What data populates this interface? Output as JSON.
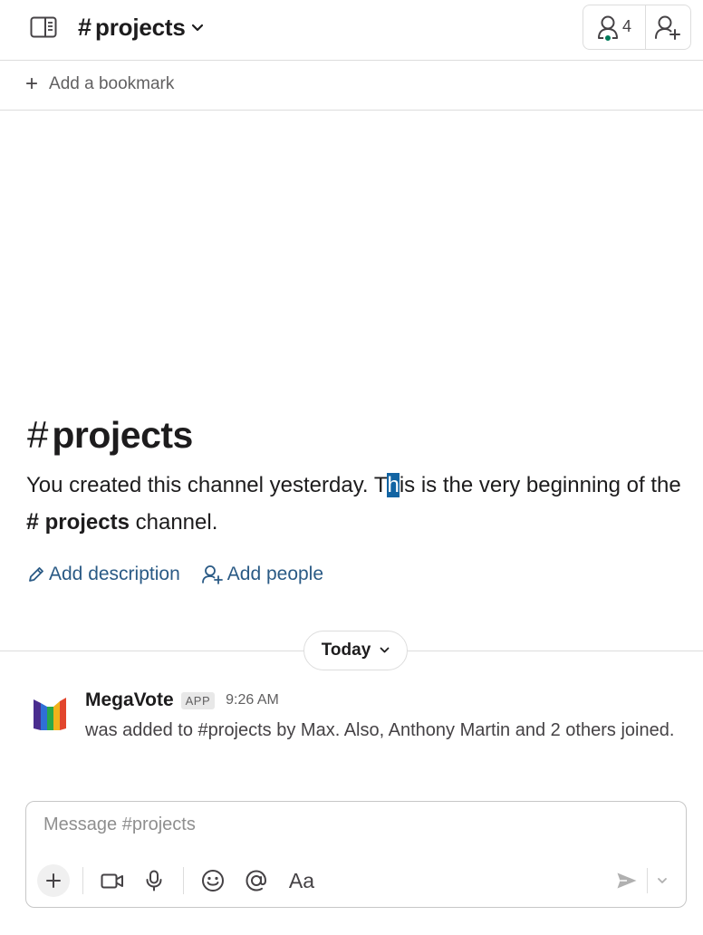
{
  "header": {
    "hash": "#",
    "channel_name": "projects",
    "member_count": "4"
  },
  "bookmarks": {
    "add_label": "Add a bookmark",
    "plus": "+"
  },
  "intro": {
    "hash": "#",
    "channel_name": "projects",
    "text_part1": "You created this channel yesterday. T",
    "text_selected": "h",
    "text_part2": "is is the very beginning of the ",
    "ref_hash": "#",
    "ref_name": "projects",
    "text_part3": " channel.",
    "add_description": "Add description",
    "add_people": "Add people"
  },
  "day_divider": {
    "label": "Today"
  },
  "message": {
    "author": "MegaVote",
    "badge": "APP",
    "time": "9:26 AM",
    "text": "was added to #projects by Max. Also, Anthony Martin and 2 others joined."
  },
  "composer": {
    "placeholder": "Message #projects",
    "format_label": "Aa"
  },
  "colors": {
    "link": "#1264a3",
    "presence": "#007a5a",
    "selection": "#1264a3"
  },
  "icons": {
    "sidebar_toggle": "sidebar-panel-icon",
    "members": "person-icon",
    "add_member": "person-add-icon",
    "pencil": "pencil-icon",
    "add_people": "person-add-icon",
    "video": "video-camera-icon",
    "mic": "microphone-icon",
    "emoji": "smiley-icon",
    "mention": "at-sign-icon",
    "send": "send-icon"
  }
}
